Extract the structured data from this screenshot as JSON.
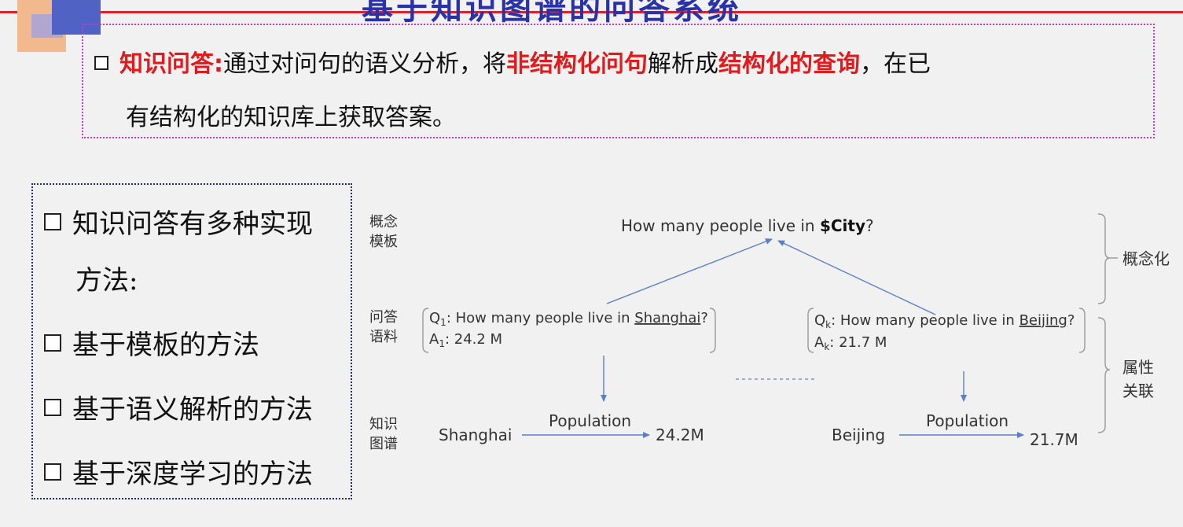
{
  "slide": {
    "title": "基于知识图谱的问答系统"
  },
  "definition": {
    "term": "知识问答:",
    "text1": "通过对问句的语义分析，将",
    "hl1": "非结构化问句",
    "text2": "解析成",
    "hl2": "结构化的查询",
    "text3": "，在已",
    "line2": "有结构化的知识库上获取答案。"
  },
  "methods": {
    "items": [
      "知识问答有多种实现",
      "方法:",
      "基于模板的方法",
      "基于语义解析的方法",
      "基于深度学习的方法"
    ]
  },
  "diagram": {
    "row_labels": {
      "concept_template": [
        "概念",
        "模板"
      ],
      "qa_corpus": [
        "问答",
        "语料"
      ],
      "kg": [
        "知识",
        "图谱"
      ]
    },
    "template_pre": "How many people live in ",
    "template_var": "$City",
    "template_post": "?",
    "qa_left": {
      "q_label": "Q",
      "q_sub": "1",
      "q_pre": ": How many people live in ",
      "q_city": "Shanghai",
      "q_post": "?",
      "a_label": "A",
      "a_sub": "1",
      "a_text": ": 24.2 M"
    },
    "qa_right": {
      "q_label": "Q",
      "q_sub": "k",
      "q_pre": ": How many people live in ",
      "q_city": "Beijing",
      "q_post": "?",
      "a_label": "A",
      "a_sub": "k",
      "a_text": ": 21.7 M"
    },
    "kg_left": {
      "subject": "Shanghai",
      "relation": "Population",
      "object": "24.2M"
    },
    "kg_right": {
      "subject": "Beijing",
      "relation": "Population",
      "object": "21.7M"
    },
    "side_labels": {
      "conceptualize": "概念化",
      "attr_assoc": [
        "属性",
        "关联"
      ]
    },
    "colors": {
      "arrow": "#5b7fc7",
      "text": "#333333",
      "bracket": "#9a9a9a",
      "dots": "#7f8fd6"
    }
  }
}
